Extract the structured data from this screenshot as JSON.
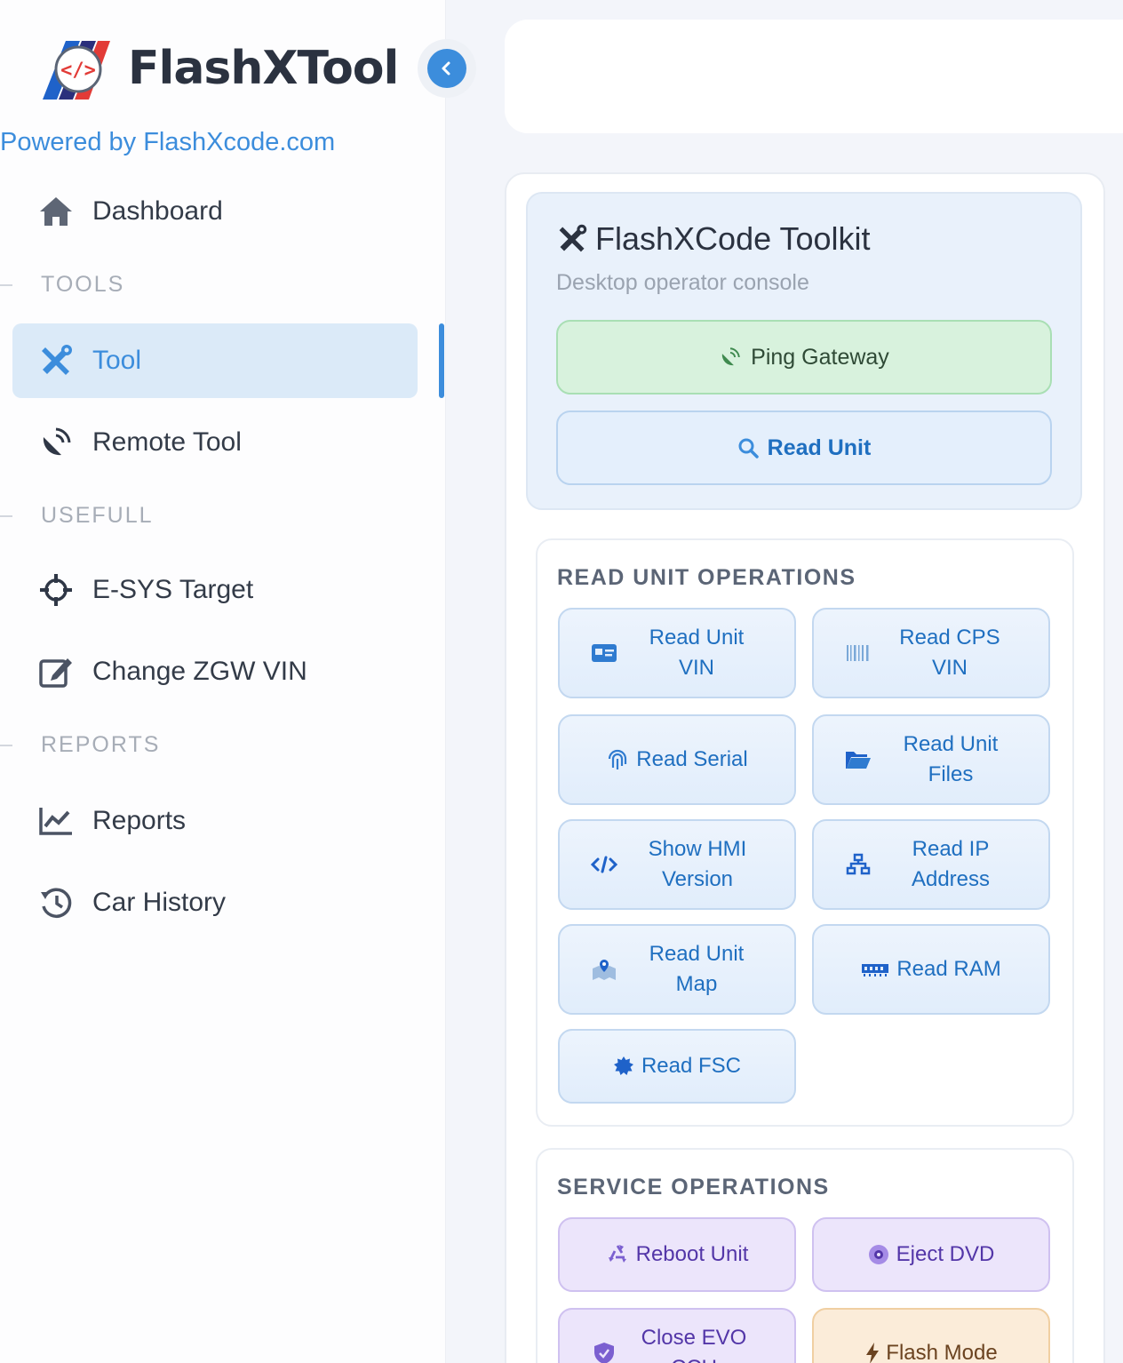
{
  "app": {
    "name": "FlashXTool",
    "powered_by": "Powered by FlashXcode.com"
  },
  "sidebar": {
    "items": [
      {
        "label": "Dashboard"
      },
      {
        "label": "Tool"
      },
      {
        "label": "Remote Tool"
      },
      {
        "label": "E-SYS Target"
      },
      {
        "label": "Change ZGW VIN"
      },
      {
        "label": "Reports"
      },
      {
        "label": "Car History"
      }
    ],
    "sections": {
      "tools": "TOOLS",
      "usefull": "USEFULL",
      "reports": "REPORTS"
    }
  },
  "toolkit": {
    "title": "FlashXCode Toolkit",
    "subtitle": "Desktop operator console",
    "ping_label": "Ping Gateway",
    "read_label": "Read Unit"
  },
  "read_ops": {
    "title": "READ UNIT OPERATIONS",
    "buttons": [
      {
        "label": "Read Unit VIN",
        "icon": "id-card-icon"
      },
      {
        "label": "Read CPS VIN",
        "icon": "barcode-icon"
      },
      {
        "label": "Read Serial",
        "icon": "fingerprint-icon"
      },
      {
        "label": "Read Unit Files",
        "icon": "folder-open-icon"
      },
      {
        "label": "Show HMI Version",
        "icon": "code-icon"
      },
      {
        "label": "Read IP Address",
        "icon": "network-icon"
      },
      {
        "label": "Read Unit Map",
        "icon": "map-marker-icon"
      },
      {
        "label": "Read RAM",
        "icon": "memory-icon"
      },
      {
        "label": "Read FSC",
        "icon": "certificate-icon"
      }
    ]
  },
  "service_ops": {
    "title": "SERVICE OPERATIONS",
    "buttons": [
      {
        "label": "Reboot Unit",
        "icon": "recycle-icon"
      },
      {
        "label": "Eject DVD",
        "icon": "disc-icon"
      },
      {
        "label": "Close EVO CCU",
        "icon": "shield-icon"
      },
      {
        "label": "Flash Mode",
        "icon": "bolt-icon"
      }
    ]
  },
  "colors": {
    "accent": "#3c8ddc",
    "active_bg": "#dbeaf8",
    "ping_bg": "#d8f2dd",
    "service_bg": "#ece5fb",
    "flash_bg": "#fbecd9"
  }
}
